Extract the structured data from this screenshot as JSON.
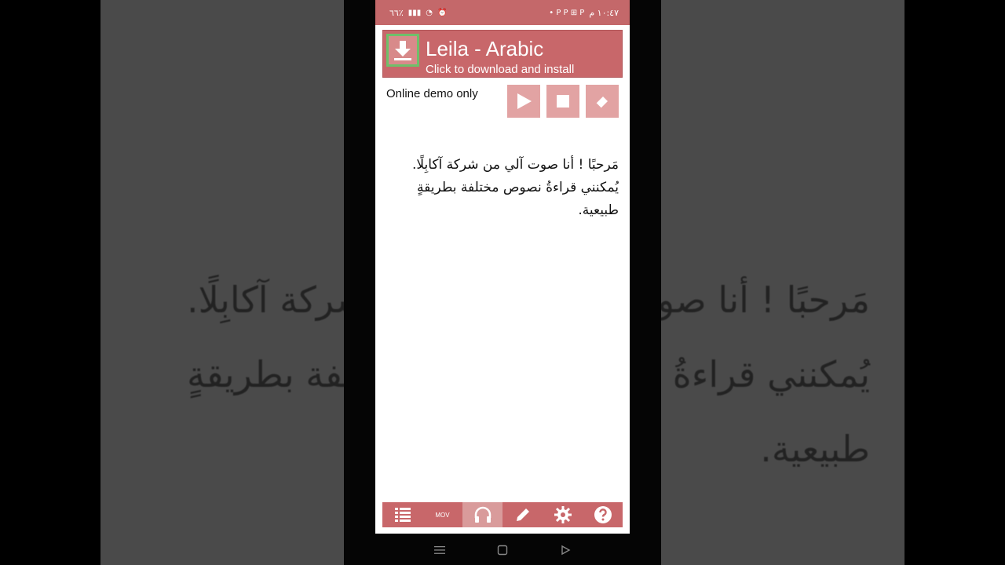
{
  "status_bar": {
    "battery": "٦٦٪",
    "time": "١٠:٤٧ م"
  },
  "banner": {
    "title": "Leila - Arabic",
    "subtitle": "Click to download and install",
    "icon": "download-icon"
  },
  "controls": {
    "demo_label": "Online demo only",
    "play_icon": "play-icon",
    "stop_icon": "stop-icon",
    "erase_icon": "eraser-icon"
  },
  "content": {
    "text_line1": "مَرحبًا ! أنا صوت آلي من شركة آكابِلًا.",
    "text_line2": "يُمكنني قراءةُ نصوص مختلفة بطريقةٍ",
    "text_line3": "طبيعية."
  },
  "bottom_bar": {
    "items": [
      {
        "icon": "list-icon"
      },
      {
        "label": "MOV"
      },
      {
        "icon": "headphones-icon"
      },
      {
        "icon": "pencil-icon"
      },
      {
        "icon": "gear-icon"
      },
      {
        "icon": "help-icon"
      }
    ],
    "active_index": 2
  },
  "colors": {
    "accent": "#c8676a",
    "button": "#e2a3a3"
  }
}
